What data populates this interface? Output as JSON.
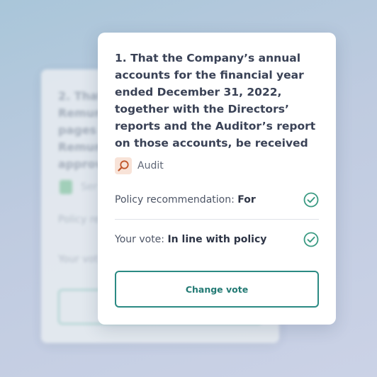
{
  "background_card": {
    "title": "2. That\nRemun\npages\nRemun\napprov",
    "tag_label": "Ser",
    "policy_label": "Policy re",
    "vote_label": "Your vot"
  },
  "proposal": {
    "title": "1. That the Company’s annual accounts for the financial year ended December 31, 2022, together with the Directors’ reports and the Auditor’s report on those accounts, be received",
    "tag": {
      "icon": "magnifier-icon",
      "label": "Audit",
      "icon_color": "#c0552a",
      "icon_bg": "#f8e3d8"
    },
    "policy": {
      "label": "Policy recommendation:",
      "value": "For"
    },
    "vote": {
      "label": "Your vote:",
      "value": "In line with policy"
    },
    "change_button": "Change vote"
  },
  "colors": {
    "accent": "#2b8a83",
    "check": "#3a9a82"
  }
}
